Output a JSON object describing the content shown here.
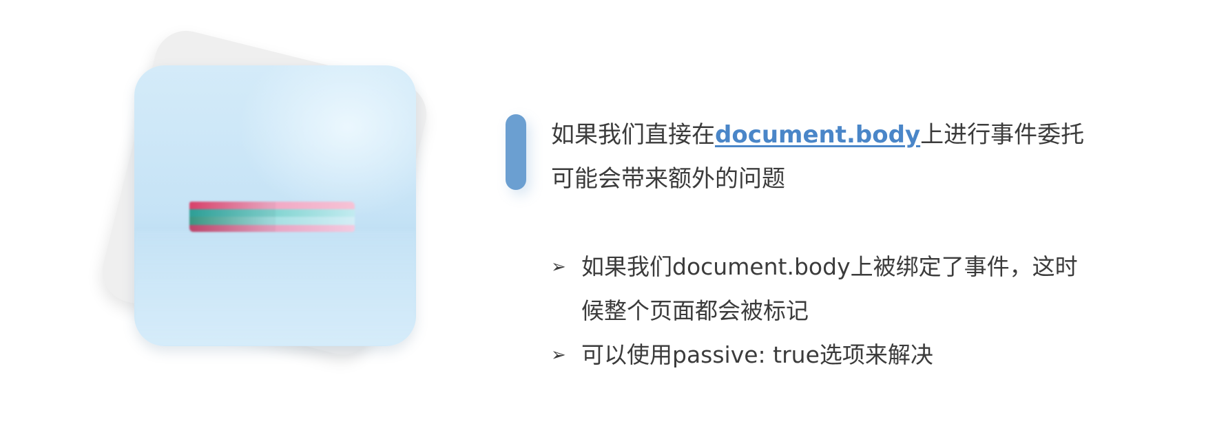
{
  "heading": {
    "line1_before": "如果我们直接在",
    "line1_code": "document.body",
    "line1_after": "上进行事件委托",
    "line2": "可能会带来额外的问题"
  },
  "bullets": [
    {
      "marker": "➢",
      "line1": "如果我们document.body上被绑定了事件，这时",
      "line2": "候整个页面都会被标记"
    },
    {
      "marker": "➢",
      "line1": "可以使用passive: true选项来解决"
    }
  ],
  "colors": {
    "accent": "#6b9fd1",
    "link": "#4a86c8",
    "text": "#3b3b3b"
  }
}
